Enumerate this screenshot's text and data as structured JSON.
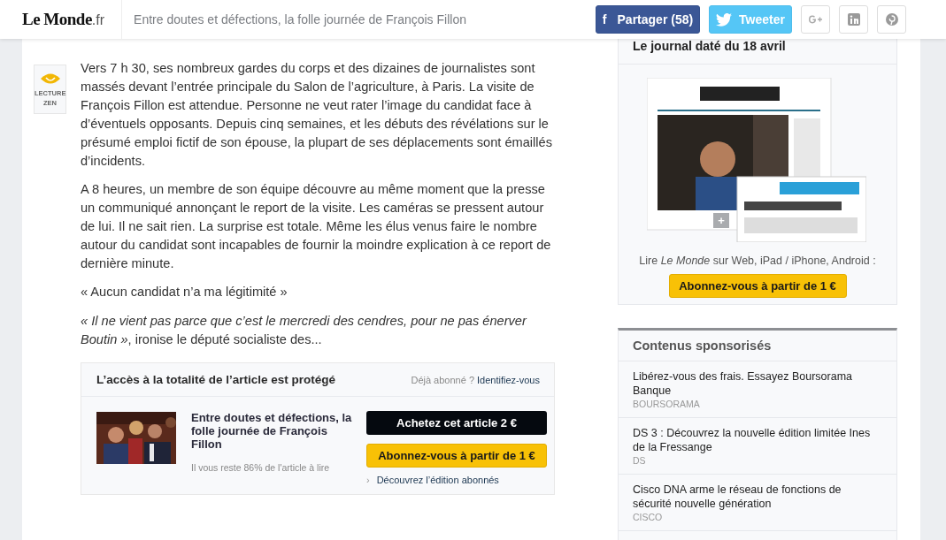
{
  "header": {
    "logo": {
      "name": "Le Monde",
      "suffix": ".fr"
    },
    "title": "Entre doutes et défections, la folle journée de François Fillon",
    "share": [
      {
        "kind": "facebook",
        "glyph": "f",
        "label": "Partager (58)"
      },
      {
        "kind": "twitter",
        "label": "Tweeter"
      },
      {
        "kind": "googleplus"
      },
      {
        "kind": "linkedin"
      },
      {
        "kind": "pinterest"
      }
    ]
  },
  "zen": {
    "label": "LECTURE ZEN"
  },
  "article": {
    "paragraphs": [
      {
        "kind": "text",
        "text": "Vers 7 h 30, ses nombreux gardes du corps et des dizaines de journalistes sont massés devant l’entrée principale du Salon de l’agriculture, à Paris. La visite de François Fillon est attendue. Personne ne veut rater l’image du candidat face à d’éventuels opposants. Depuis cinq semaines, et les débuts des révélations sur le présumé emploi fictif de son épouse, la plupart de ses déplacements sont émaillés d’incidents."
      },
      {
        "kind": "text",
        "text": "A 8 heures, un membre de son équipe découvre au même moment que la presse un communiqué annonçant le report de la visite. Les caméras se pressent autour de lui. Il ne sait rien. La surprise est totale. Même les élus venus faire le nombre autour du candidat sont incapables de fournir la moindre explication à ce report de dernière minute."
      },
      {
        "kind": "subheading",
        "text": "« Aucun candidat n’a ma légitimité »"
      },
      {
        "kind": "text",
        "text": "*« Il ne vient pas parce que c’est le mercredi des cendres, pour ne pas énerver Boutin »*, ironise le député socialiste des..."
      }
    ]
  },
  "paywall": {
    "title": "L’accès à la totalité de l’article est protégé",
    "login_prompt": "Déjà abonné ?",
    "login_link": "Identifiez-vous",
    "article_title": "Entre doutes et défections, la folle journée de François Fillon",
    "remaining": "Il vous reste 86% de l'article à lire",
    "buy_button": "Achetez cet article 2 €",
    "subscribe_button": "Abonnez-vous à partir de 1 €",
    "discover_glyph": "›",
    "discover_link": "Découvrez l’édition abonnés"
  },
  "sidebar": {
    "journal": {
      "title": "Le journal daté du 18 avril",
      "expand_button": "+",
      "caption": "Lire *Le Monde* sur Web, iPad / iPhone, Android :",
      "subscribe_button": "Abonnez-vous à partir de 1 €"
    },
    "sponsored": {
      "title": "Contenus sponsorisés",
      "items": [
        {
          "headline": "Libérez-vous des frais. Essayez Boursorama Banque",
          "source": "BOURSORAMA"
        },
        {
          "headline": "DS 3 : Découvrez la nouvelle édition limitée Ines de la Fressange",
          "source": "DS"
        },
        {
          "headline": "Cisco DNA arme le réseau de fonctions de sécurité nouvelle génération",
          "source": "CISCO"
        }
      ]
    }
  }
}
